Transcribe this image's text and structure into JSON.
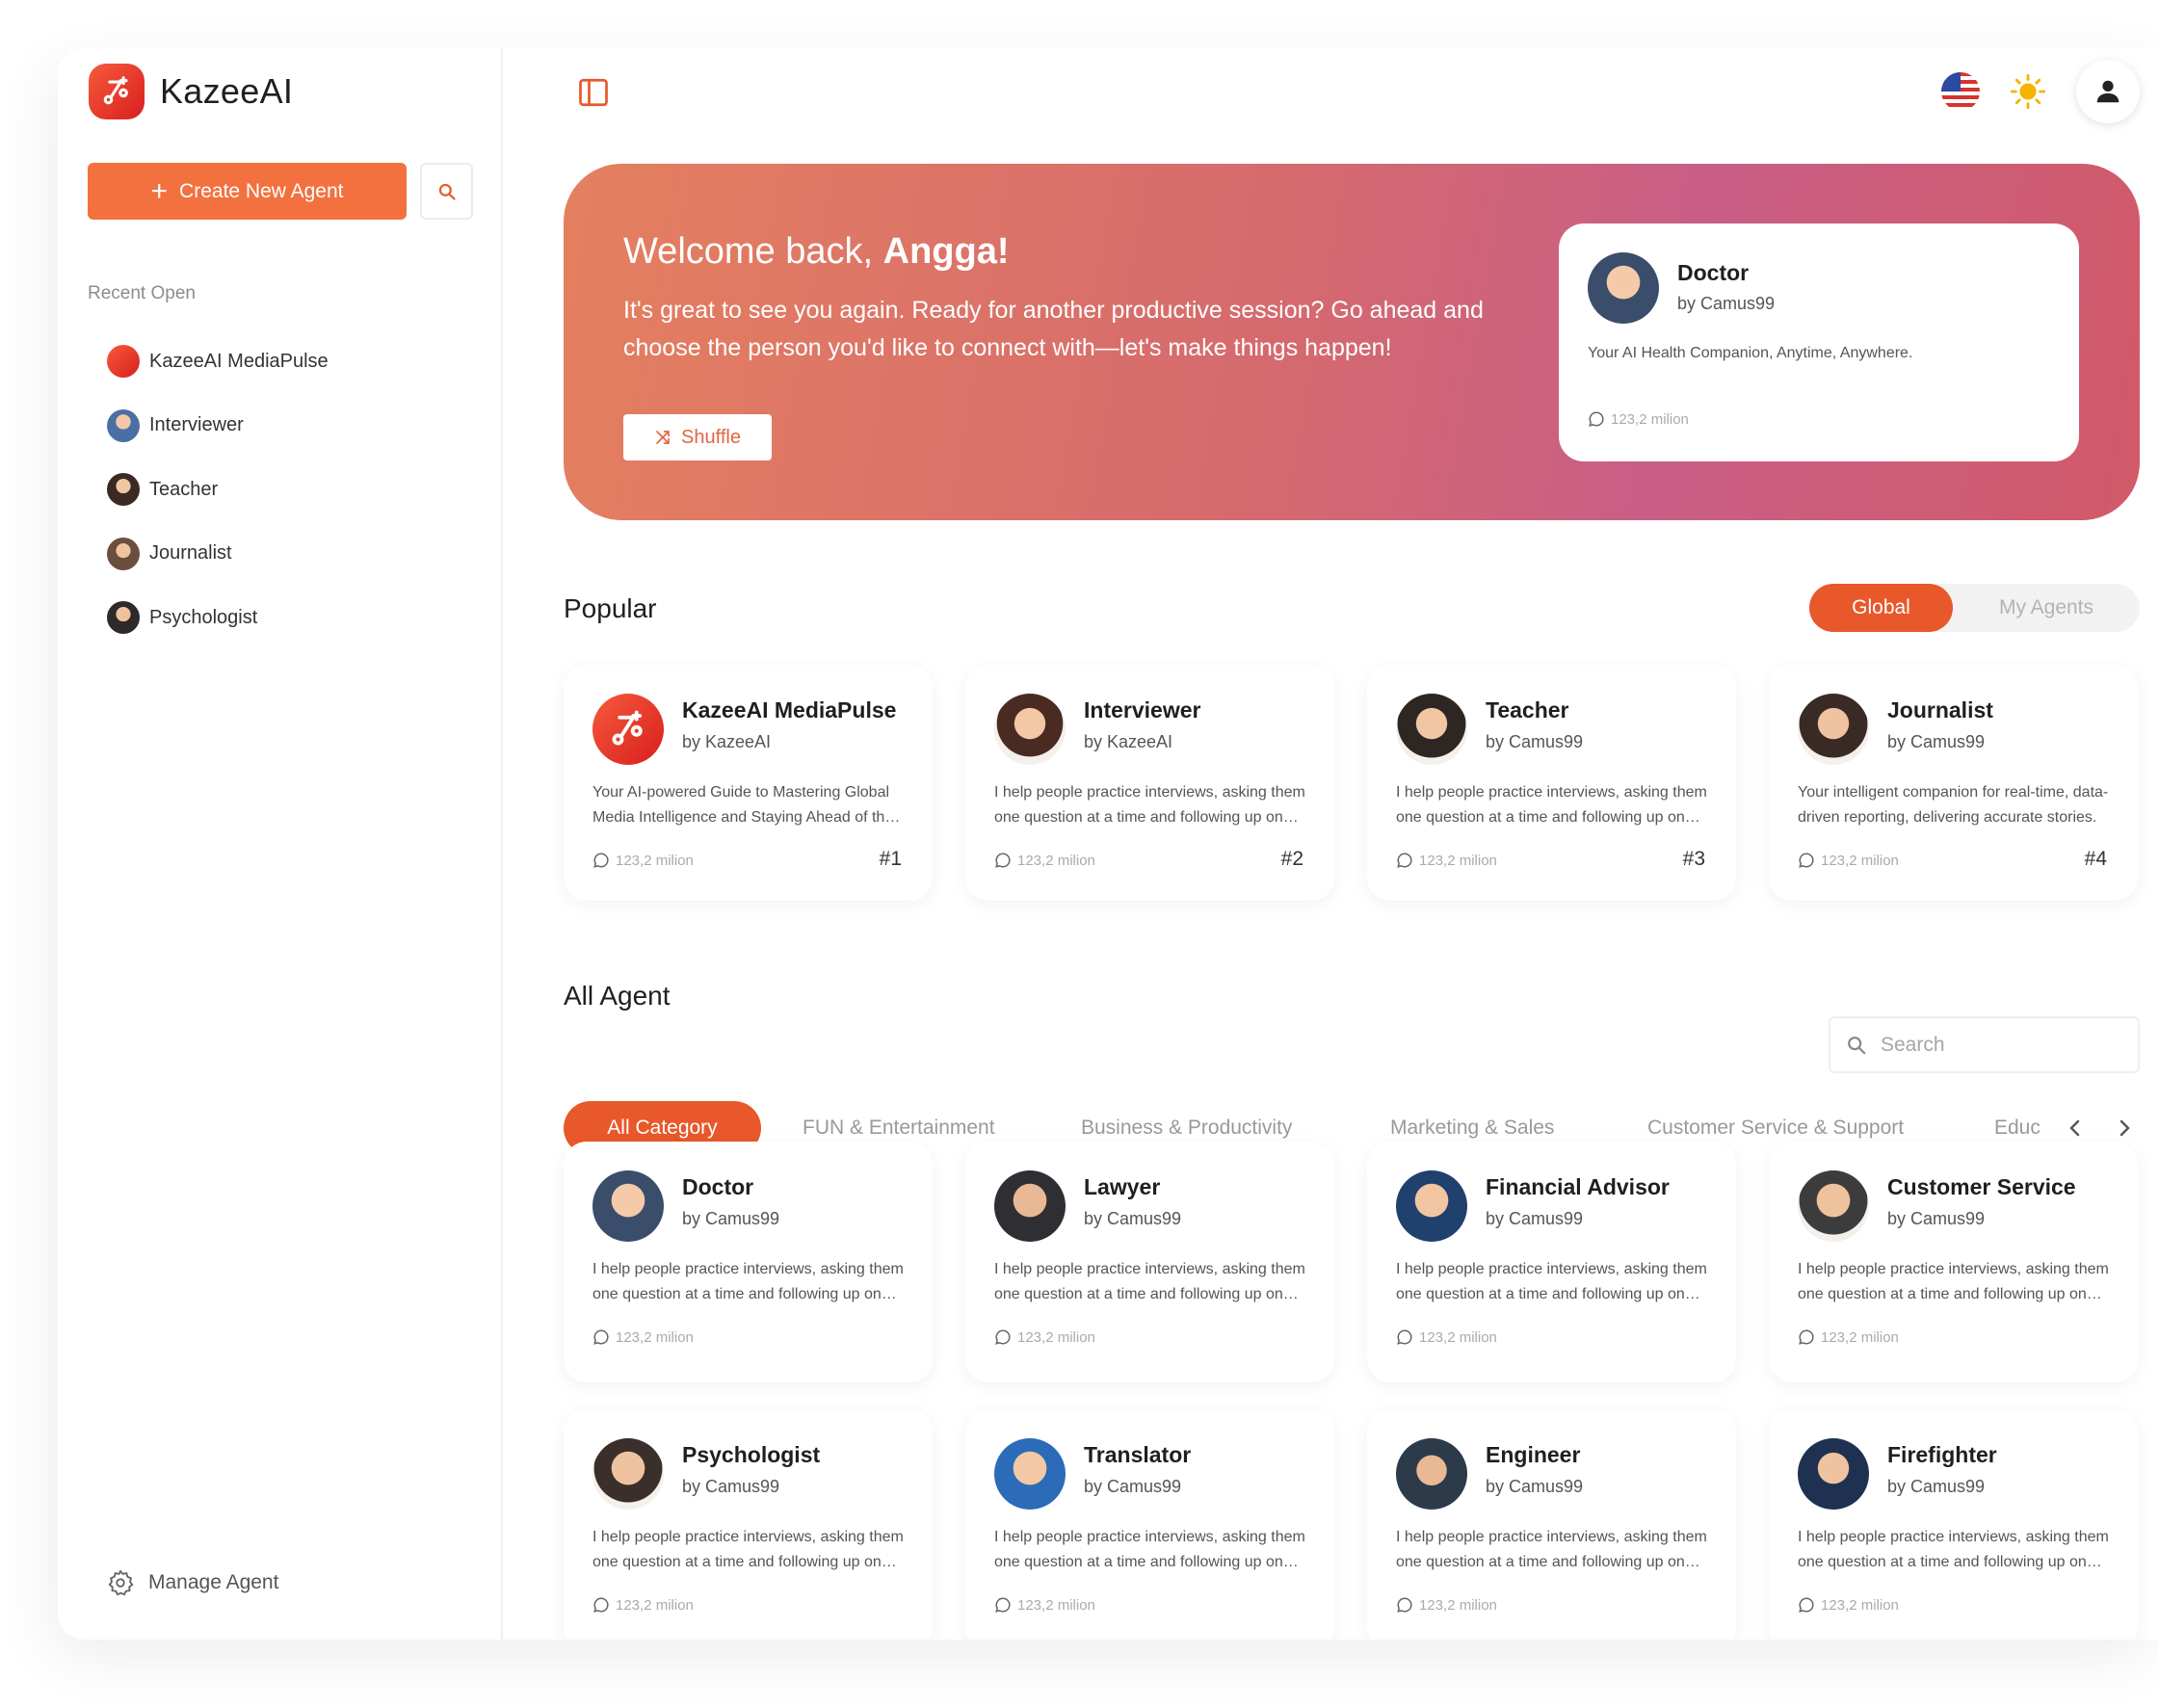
{
  "brand": {
    "name": "KazeeAI"
  },
  "colors": {
    "accent": "#e8582a",
    "create": "#f2713f",
    "hero_start": "#e4805f",
    "hero_end": "#c85e86"
  },
  "sidebar": {
    "create_label": "Create New Agent",
    "recent_title": "Recent Open",
    "recent": [
      {
        "label": "KazeeAI MediaPulse"
      },
      {
        "label": "Interviewer"
      },
      {
        "label": "Teacher"
      },
      {
        "label": "Journalist"
      },
      {
        "label": "Psychologist"
      }
    ],
    "manage_label": "Manage Agent"
  },
  "hero": {
    "greeting": "Welcome back, ",
    "user": "Angga!",
    "text": "It's great to see you again. Ready for another productive session? Go ahead and choose the person you'd like to connect with—let's make things happen!",
    "shuffle_label": "Shuffle",
    "featured": {
      "name": "Doctor",
      "by": "by Camus99",
      "desc": "Your AI Health Companion, Anytime, Anywhere.",
      "count": "123,2 milion"
    }
  },
  "popular": {
    "title": "Popular",
    "toggle": {
      "global": "Global",
      "mine": "My Agents"
    },
    "cards": [
      {
        "name": "KazeeAI MediaPulse",
        "by": "by KazeeAI",
        "desc": "Your AI-powered Guide to Mastering Global Media Intelligence and Staying Ahead of the Curve.",
        "count": "123,2 milion",
        "rank": "#1"
      },
      {
        "name": "Interviewer",
        "by": "by KazeeAI",
        "desc": "I help people practice interviews, asking them one question at a time and following up on answers.",
        "count": "123,2 milion",
        "rank": "#2"
      },
      {
        "name": "Teacher",
        "by": "by Camus99",
        "desc": "I help people practice interviews, asking them one question at a time and following up on answers.",
        "count": "123,2 milion",
        "rank": "#3"
      },
      {
        "name": "Journalist",
        "by": "by Camus99",
        "desc": "Your intelligent companion for real-time, data-driven reporting, delivering accurate stories.",
        "count": "123,2 milion",
        "rank": "#4"
      }
    ]
  },
  "all": {
    "title": "All Agent",
    "search_placeholder": "Search",
    "tabs": [
      "All Category",
      "FUN & Entertainment",
      "Business & Productivity",
      "Marketing & Sales",
      "Customer Service & Support",
      "Educ"
    ],
    "cards": [
      {
        "name": "Doctor",
        "by": "by Camus99",
        "desc": "I help people practice interviews, asking them one question at a time and following up on answers.",
        "count": "123,2 milion"
      },
      {
        "name": "Lawyer",
        "by": "by Camus99",
        "desc": "I help people practice interviews, asking them one question at a time and following up on answers.",
        "count": "123,2 milion"
      },
      {
        "name": "Financial Advisor",
        "by": "by Camus99",
        "desc": "I help people practice interviews, asking them one question at a time and following up on answers.",
        "count": "123,2 milion"
      },
      {
        "name": "Customer Service",
        "by": "by Camus99",
        "desc": "I help people practice interviews, asking them one question at a time and following up on answers.",
        "count": "123,2 milion"
      },
      {
        "name": "Psychologist",
        "by": "by Camus99",
        "desc": "I help people practice interviews, asking them one question at a time and following up on answers.",
        "count": "123,2 milion"
      },
      {
        "name": "Translator",
        "by": "by Camus99",
        "desc": "I help people practice interviews, asking them one question at a time and following up on answers.",
        "count": "123,2 milion"
      },
      {
        "name": "Engineer",
        "by": "by Camus99",
        "desc": "I help people practice interviews, asking them one question at a time and following up on answers.",
        "count": "123,2 milion"
      },
      {
        "name": "Firefighter",
        "by": "by Camus99",
        "desc": "I help people practice interviews, asking them one question at a time and following up on answers.",
        "count": "123,2 milion"
      }
    ]
  }
}
